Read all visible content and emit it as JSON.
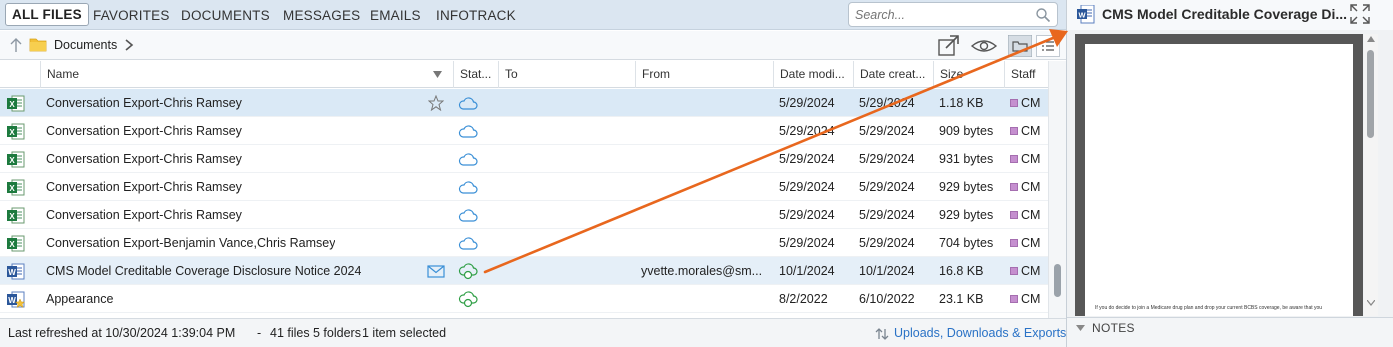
{
  "tabs": [
    {
      "label": "ALL FILES"
    },
    {
      "label": "FAVORITES"
    },
    {
      "label": "DOCUMENTS"
    },
    {
      "label": "MESSAGES"
    },
    {
      "label": "EMAILS"
    },
    {
      "label": "INFOTRACK"
    }
  ],
  "search": {
    "placeholder": "Search..."
  },
  "breadcrumb": {
    "folder": "Documents"
  },
  "columns": {
    "name": "Name",
    "status": "Stat...",
    "to": "To",
    "from": "From",
    "date_modified": "Date modi...",
    "date_created": "Date creat...",
    "size": "Size",
    "staff": "Staff"
  },
  "rows": [
    {
      "icon": "excel-file-icon",
      "name": "Conversation Export-Chris Ramsey",
      "to": "",
      "from": "",
      "date_modified": "5/29/2024",
      "date_created": "5/29/2024",
      "size": "1.18 KB",
      "staff": "CM"
    },
    {
      "icon": "excel-file-icon",
      "name": "Conversation Export-Chris Ramsey",
      "to": "",
      "from": "",
      "date_modified": "5/29/2024",
      "date_created": "5/29/2024",
      "size": "909 bytes",
      "staff": "CM"
    },
    {
      "icon": "excel-file-icon",
      "name": "Conversation Export-Chris Ramsey",
      "to": "",
      "from": "",
      "date_modified": "5/29/2024",
      "date_created": "5/29/2024",
      "size": "931 bytes",
      "staff": "CM"
    },
    {
      "icon": "excel-file-icon",
      "name": "Conversation Export-Chris Ramsey",
      "to": "",
      "from": "",
      "date_modified": "5/29/2024",
      "date_created": "5/29/2024",
      "size": "929 bytes",
      "staff": "CM"
    },
    {
      "icon": "excel-file-icon",
      "name": "Conversation Export-Chris Ramsey",
      "to": "",
      "from": "",
      "date_modified": "5/29/2024",
      "date_created": "5/29/2024",
      "size": "929 bytes",
      "staff": "CM"
    },
    {
      "icon": "excel-file-icon",
      "name": "Conversation Export-Benjamin Vance,Chris Ramsey",
      "to": "",
      "from": "",
      "date_modified": "5/29/2024",
      "date_created": "5/29/2024",
      "size": "704 bytes",
      "staff": "CM"
    },
    {
      "icon": "word-file-icon",
      "name": "CMS Model Creditable Coverage Disclosure Notice 2024",
      "to": "",
      "from": "yvette.morales@sm...",
      "date_modified": "10/1/2024",
      "date_created": "10/1/2024",
      "size": "16.8 KB",
      "staff": "CM"
    },
    {
      "icon": "word-template-icon",
      "name": "Appearance",
      "to": "",
      "from": "",
      "date_modified": "8/2/2022",
      "date_created": "6/10/2022",
      "size": "23.1 KB",
      "staff": "CM"
    }
  ],
  "status_bar": {
    "refreshed": "Last refreshed at 10/30/2024 1:39:04 PM",
    "separator": "-",
    "files": "41 files",
    "folders": "5 folders",
    "selected": "1 item selected",
    "uploads": "Uploads, Downloads & Exports"
  },
  "preview": {
    "title": "CMS Model Creditable Coverage Di...",
    "doc_snippet": "If you do decide to join a Medicare drug plan and drop your current BCBS coverage, be aware that you",
    "notes_label": "NOTES"
  },
  "colors": {
    "tab_bar": "#dbe6f1",
    "selection": "#dae9f6",
    "link": "#2a72c6",
    "annotation_arrow": "#e8671e",
    "staff_badge": "#c58fcf"
  }
}
